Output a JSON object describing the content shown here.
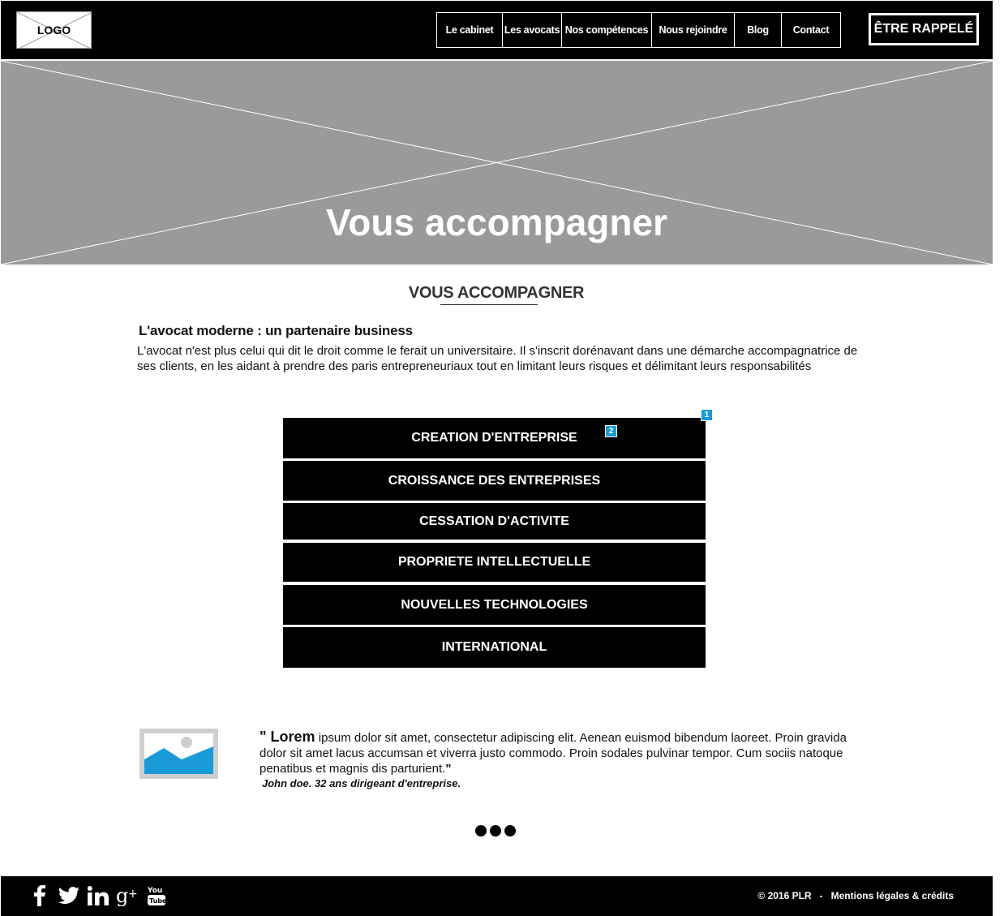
{
  "header": {
    "logo_text": "LOGO",
    "nav": [
      {
        "label": "Le cabinet"
      },
      {
        "label": "Les avocats"
      },
      {
        "label": "Nos compétences"
      },
      {
        "label": "Nous rejoindre"
      },
      {
        "label": "Blog"
      },
      {
        "label": "Contact"
      }
    ],
    "cta_label": "ÊTRE RAPPELÉ"
  },
  "hero": {
    "title": "Vous accompagner"
  },
  "main": {
    "section_title": "VOUS ACCOMPAGNER",
    "intro_heading": "L'avocat moderne : un partenaire business",
    "intro_text": "L'avocat n'est plus celui qui dit le droit comme le ferait un universitaire. Il s'inscrit dorénavant dans une démarche accompagnatrice de ses clients, en les aidant à prendre des paris entrepreneuriaux tout en limitant leurs risques et délimitant leurs responsabilités",
    "services": [
      {
        "label": "CREATION D'ENTREPRISE"
      },
      {
        "label": "CROISSANCE DES ENTREPRISES"
      },
      {
        "label": "CESSATION D'ACTIVITE"
      },
      {
        "label": "PROPRIETE INTELLECTUELLE"
      },
      {
        "label": "NOUVELLES TECHNOLOGIES"
      },
      {
        "label": "INTERNATIONAL"
      }
    ],
    "badges": [
      "1",
      "2"
    ]
  },
  "testimonial": {
    "quote_mark": "\" ",
    "quote_lead": "Lorem",
    "quote_body": " ipsum dolor sit amet, consectetur adipiscing elit. Aenean euismod bibendum laoreet. Proin gravida dolor sit amet lacus accumsan et viverra justo commodo. Proin sodales pulvinar tempor. Cum sociis natoque penatibus et magnis dis parturient.",
    "quote_end": "\"",
    "author": "John doe. 32 ans dirigeant d'entreprise."
  },
  "footer": {
    "social_icons": [
      "facebook-icon",
      "twitter-icon",
      "linkedin-icon",
      "google-plus-icon",
      "youtube-icon"
    ],
    "copyright": "© 2016 PLR",
    "separator": "-",
    "legal_link": "Mentions légales & crédits"
  },
  "colors": {
    "accent_badge": "#1a9bd7",
    "header_bg": "#000000",
    "hero_bg": "#9a9a9a"
  }
}
